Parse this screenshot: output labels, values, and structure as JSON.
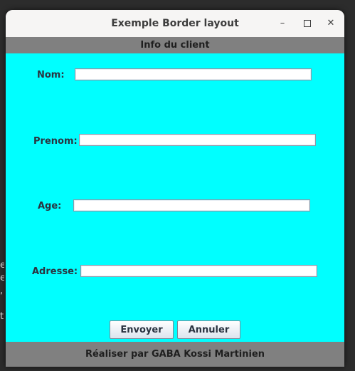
{
  "window": {
    "title": "Exemple Border layout",
    "minimize_glyph": "–",
    "close_glyph": "✕"
  },
  "header": {
    "text": "Info du client"
  },
  "form": {
    "fields": [
      {
        "label": "Nom:",
        "value": ""
      },
      {
        "label": "Prenom:",
        "value": ""
      },
      {
        "label": "Age:",
        "value": ""
      },
      {
        "label": "Adresse:",
        "value": ""
      }
    ]
  },
  "buttons": {
    "send": "Envoyer",
    "cancel": "Annuler"
  },
  "footer": {
    "text": "Réaliser par GABA Kossi Martinien"
  },
  "colors": {
    "content_bg": "#00ffff",
    "band_bg": "#808080"
  },
  "icons": {
    "minimize": "minimize-icon",
    "maximize": "maximize-icon",
    "close": "close-icon"
  }
}
